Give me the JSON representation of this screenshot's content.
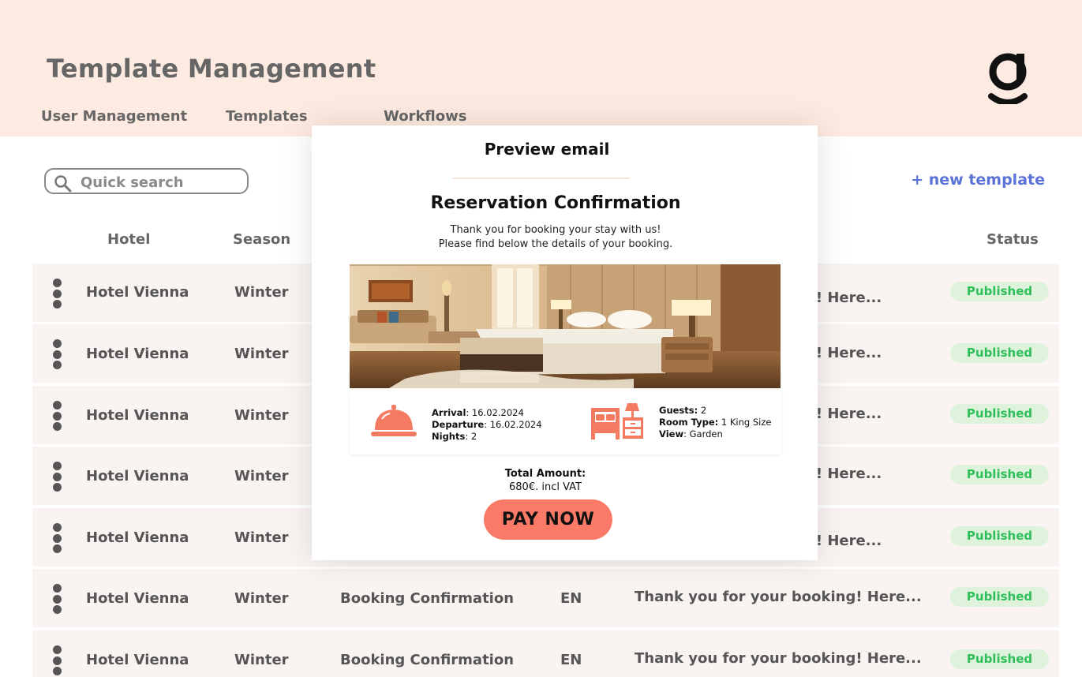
{
  "header": {
    "title": "Template Management",
    "nav": [
      "User Management",
      "Templates",
      "Workflows"
    ]
  },
  "toolbar": {
    "search_placeholder": "Quick search",
    "new_template_label": "+ new template"
  },
  "table": {
    "columns": {
      "hotel": "Hotel",
      "season": "Season",
      "status": "Status"
    },
    "rows": [
      {
        "hotel": "Hotel Vienna",
        "season": "Winter",
        "template": "",
        "language": "",
        "preview": "g! Here...",
        "status": "Published"
      },
      {
        "hotel": "Hotel Vienna",
        "season": "Winter",
        "template": "",
        "language": "",
        "preview": "g! Here...",
        "status": "Published"
      },
      {
        "hotel": "Hotel Vienna",
        "season": "Winter",
        "template": "",
        "language": "",
        "preview": "g! Here...",
        "status": "Published"
      },
      {
        "hotel": "Hotel Vienna",
        "season": "Winter",
        "template": "",
        "language": "",
        "preview": "g! Here...",
        "status": "Published"
      },
      {
        "hotel": "Hotel Vienna",
        "season": "Winter",
        "template": "",
        "language": "",
        "preview": "g! Here...",
        "status": "Published"
      },
      {
        "hotel": "Hotel Vienna",
        "season": "Winter",
        "template": "Booking Confirmation",
        "language": "EN",
        "preview": "Thank you for your booking! Here...",
        "status": "Published"
      },
      {
        "hotel": "Hotel Vienna",
        "season": "Winter",
        "template": "Booking Confirmation",
        "language": "EN",
        "preview": "Thank you for your booking! Here...",
        "status": "Published"
      }
    ]
  },
  "modal": {
    "title": "Preview email",
    "email": {
      "heading": "Reservation Confirmation",
      "intro_line1": "Thank you for booking your stay with us!",
      "intro_line2": "Please find below the details of your booking.",
      "arrival_label": "Arrival",
      "arrival_value": ": 16.02.2024",
      "departure_label": "Departure",
      "departure_value": ": 16.02.2024",
      "nights_label": "Nights",
      "nights_value": ": 2",
      "guests_label": "Guests:",
      "guests_value": " 2",
      "room_type_label": "Room Type:",
      "room_type_value": " 1 King Size",
      "view_label": "View",
      "view_value": ": Garden",
      "total_label": "Total Amount:",
      "total_value": "680€. incl VAT",
      "pay_button": "PAY NOW"
    }
  },
  "colors": {
    "header_bg": "#fdeae0",
    "accent": "#fb7a67",
    "link": "#5b73d6",
    "badge_bg": "#dff3dc",
    "badge_text": "#2fbf5a"
  },
  "icons": [
    "search-icon",
    "logo-g-icon",
    "kebab-menu-icon",
    "service-bell-icon",
    "bed-nightstand-icon"
  ]
}
